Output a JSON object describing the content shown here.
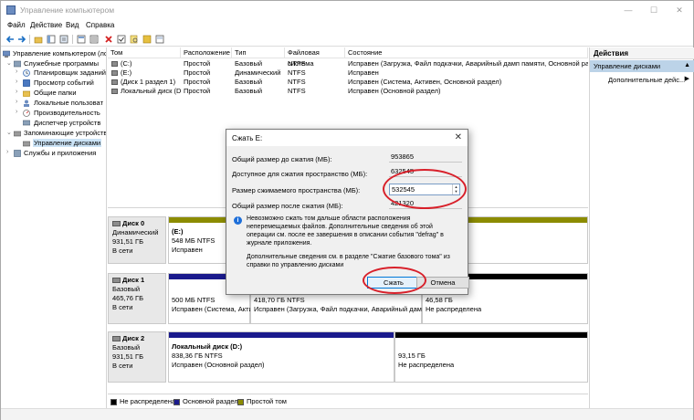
{
  "window": {
    "title": "Управление компьютером",
    "minimize": "—",
    "maximize": "☐",
    "close": "✕"
  },
  "menu": [
    "Файл",
    "Действие",
    "Вид",
    "Справка"
  ],
  "tree": [
    "Управление компьютером (лс",
    "Служебные программы",
    "Планировщик заданий",
    "Просмотр событий",
    "Общие папки",
    "Локальные пользоват",
    "Производительность",
    "Диспетчер устройств",
    "Запоминающие устройств",
    "Управление дисками",
    "Службы и приложения"
  ],
  "volume_list": {
    "columns": [
      "Том",
      "Расположение",
      "Тип",
      "Файловая система",
      "Состояние"
    ],
    "rows": [
      [
        "(C:)",
        "Простой",
        "Базовый",
        "NTFS",
        "Исправен (Загрузка, Файл подкачки, Аварийный дамп памяти, Основной разде"
      ],
      [
        "(E:)",
        "Простой",
        "Динамический",
        "NTFS",
        "Исправен"
      ],
      [
        "(Диск 1 раздел 1)",
        "Простой",
        "Базовый",
        "NTFS",
        "Исправен (Система, Активен, Основной раздел)"
      ],
      [
        "Локальный диск (D:)",
        "Простой",
        "Базовый",
        "NTFS",
        "Исправен (Основной раздел)"
      ]
    ]
  },
  "disks": [
    {
      "name": "Диск 0",
      "type": "Динамический",
      "size": "931,51 ГБ",
      "status": "В сети",
      "partitions": [
        {
          "title": "(E:)",
          "line1": "548 МБ NTFS",
          "line2": "Исправен"
        }
      ]
    },
    {
      "name": "Диск 1",
      "type": "Базовый",
      "size": "465,76 ГБ",
      "status": "В сети",
      "partitions": [
        {
          "title": "",
          "line1": "500 МБ NTFS",
          "line2": "Исправен (Система, Акти"
        },
        {
          "title": "",
          "line1": "418,70 ГБ NTFS",
          "line2": "Исправен (Загрузка, Файл подкачки, Аварийный дамп"
        },
        {
          "title": "",
          "line1": "46,58 ГБ",
          "line2": "Не распределена"
        }
      ]
    },
    {
      "name": "Диск 2",
      "type": "Базовый",
      "size": "931,51 ГБ",
      "status": "В сети",
      "partitions": [
        {
          "title": "Локальный диск (D:)",
          "line1": "838,36 ГБ NTFS",
          "line2": "Исправен (Основной раздел)"
        },
        {
          "title": "",
          "line1": "93,15 ГБ",
          "line2": "Не распределена"
        }
      ]
    }
  ],
  "legend": [
    {
      "label": "Не распределена",
      "color": "#000000"
    },
    {
      "label": "Основной раздел",
      "color": "#1a1a8c"
    },
    {
      "label": "Простой том",
      "color": "#8c8c00"
    }
  ],
  "actions": {
    "header": "Действия",
    "section": "Управление дисками",
    "section_arrow": "▲",
    "item": "Дополнительные дейс...",
    "item_arrow": "▶"
  },
  "dialog": {
    "title": "Сжать E:",
    "close": "✕",
    "total_label": "Общий размер до сжатия (МБ):",
    "total_value": "953865",
    "available_label": "Доступное для сжатия пространство (МБ):",
    "available_value": "632545",
    "shrink_label": "Размер сжимаемого пространства (МБ):",
    "shrink_value": "532545",
    "after_label": "Общий размер после сжатия (МБ):",
    "after_value": "421320",
    "info_icon": "i",
    "info_text": "Невозможно сжать том дальше области расположения неперемещаемых файлов. Дополнительные сведения об этой операции см. после ее завершения в описании события \"defrag\" в журнале приложения.",
    "extra_text": "Дополнительные сведения см. в разделе \"Сжатие базового тома\" из справки по управлению дисками",
    "shrink_button": "Сжать",
    "cancel_button": "Отмена"
  },
  "colors": {
    "unallocated": "#000000",
    "primary_partition": "#1a1a8c",
    "simple_volume": "#8c8c00",
    "annotation": "#d8202a"
  }
}
